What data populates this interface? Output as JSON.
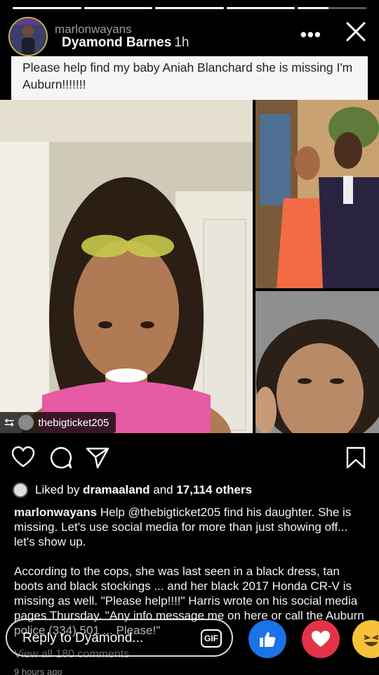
{
  "progress": [
    1,
    1,
    1,
    1,
    0.45
  ],
  "story": {
    "ghost_username": "marlonwayans",
    "owner_name": "Dyamond Barnes",
    "time": "1h",
    "more_label": "•••"
  },
  "card": {
    "text": "Please help find my baby Aniah Blanchard she is missing I'm Auburn!!!!!!!"
  },
  "repost": {
    "icon": "⮀",
    "username": "thebigticket205"
  },
  "post": {
    "liked_by_prefix": "Liked by",
    "liked_by_user": "dramaaland",
    "liked_by_suffix": "and",
    "likes_count": "17,114 others",
    "caption_user": "marlonwayans",
    "caption_text": "Help @thebigticket205 find his daughter. She is missing. Let's use social media for more than just showing off... let's show up.",
    "caption_body": "According to the cops, she was last seen in a black dress, tan boots and black stockings ... and her black 2017 Honda CR-V is missing as well. \"Please help!!!!\" Harris wrote on his social media pages Thursday. \"Any info message me on here or call the Auburn police (334) 501 ... Please!\"",
    "view_comments": "View all 180 comments",
    "time_ago": "9 hours ago"
  },
  "reply": {
    "placeholder": "Reply to Dyamond...",
    "gif_label": "GIF"
  },
  "icons": {
    "heart": "heart-icon",
    "comment": "comment-icon",
    "share": "paper-plane-icon",
    "bookmark": "bookmark-icon",
    "close": "close-icon"
  },
  "colors": {
    "like_blue": "#1a73e8",
    "love_red": "#e3334a",
    "haha_yellow": "#f7c23a",
    "ring_gold": "#c9b14a"
  }
}
